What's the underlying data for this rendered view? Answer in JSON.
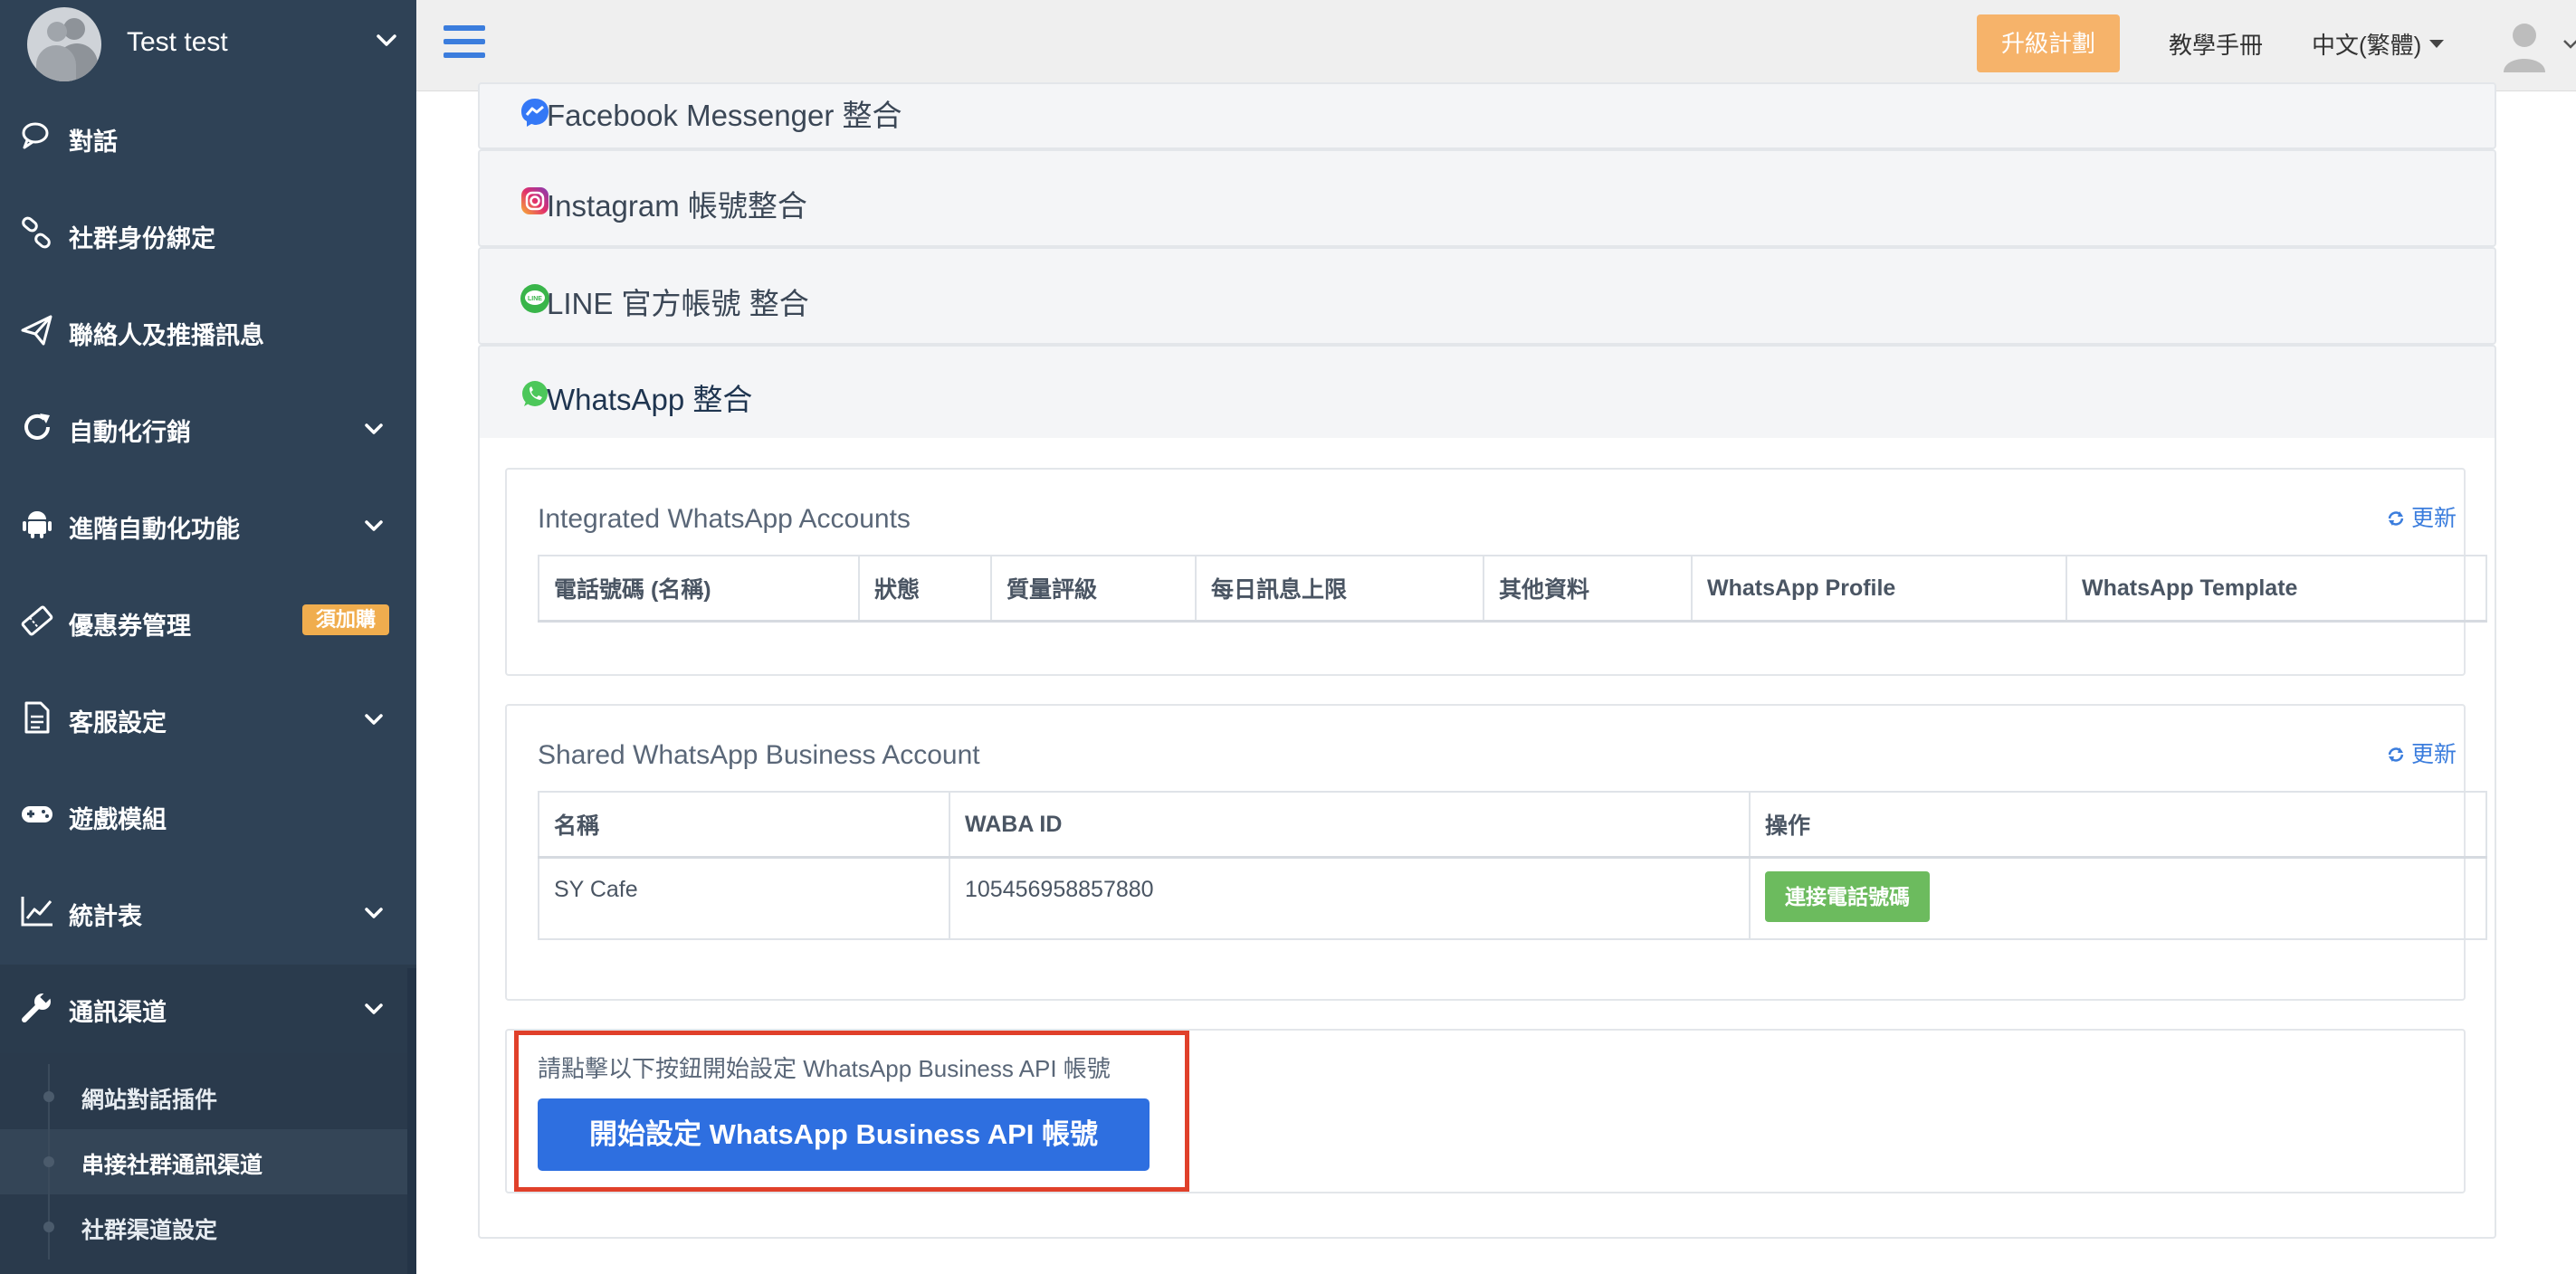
{
  "sidebar": {
    "username": "Test test",
    "items": [
      {
        "label": "對話",
        "icon": "chat-icon"
      },
      {
        "label": "社群身份綁定",
        "icon": "link-icon"
      },
      {
        "label": "聯絡人及推播訊息",
        "icon": "paper-plane-icon"
      },
      {
        "label": "自動化行銷",
        "icon": "refresh-icon"
      },
      {
        "label": "進階自動化功能",
        "icon": "android-icon"
      },
      {
        "label": "優惠券管理",
        "icon": "ticket-icon",
        "badge": "須加購"
      },
      {
        "label": "客服設定",
        "icon": "document-icon"
      },
      {
        "label": "遊戲模組",
        "icon": "gamepad-icon"
      },
      {
        "label": "統計表",
        "icon": "line-chart-icon"
      },
      {
        "label": "通訊渠道",
        "icon": "wrench-icon"
      }
    ],
    "subitems": [
      {
        "label": "網站對話插件"
      },
      {
        "label": "串接社群通訊渠道"
      },
      {
        "label": "社群渠道設定"
      }
    ]
  },
  "header": {
    "upgrade": "升級計劃",
    "tutorial": "教學手冊",
    "language": "中文(繁體)"
  },
  "integrations": {
    "messenger": "Facebook Messenger 整合",
    "instagram": "Instagram 帳號整合",
    "line": "LINE 官方帳號 整合",
    "whatsapp": "WhatsApp 整合"
  },
  "integrated_accounts": {
    "title": "Integrated WhatsApp Accounts",
    "refresh": "更新",
    "columns": [
      "電話號碼 (名稱)",
      "狀態",
      "質量評級",
      "每日訊息上限",
      "其他資料",
      "WhatsApp Profile",
      "WhatsApp Template"
    ]
  },
  "shared_accounts": {
    "title": "Shared WhatsApp Business Account",
    "refresh": "更新",
    "columns": [
      "名稱",
      "WABA ID",
      "操作"
    ],
    "rows": [
      {
        "name": "SY Cafe",
        "waba_id": "105456958857880",
        "action": "連接電話號碼"
      }
    ]
  },
  "setup": {
    "hint": "請點擊以下按鈕開始設定 WhatsApp Business API 帳號",
    "button": "開始設定 WhatsApp Business API 帳號"
  },
  "colors": {
    "sidebar_bg": "#2f4256",
    "accent_blue": "#2e6fe0",
    "upgrade_orange": "#f6b36a",
    "action_green": "#6cbb5e",
    "badge_orange": "#f0ad4e",
    "highlight_red": "#e0402a"
  }
}
